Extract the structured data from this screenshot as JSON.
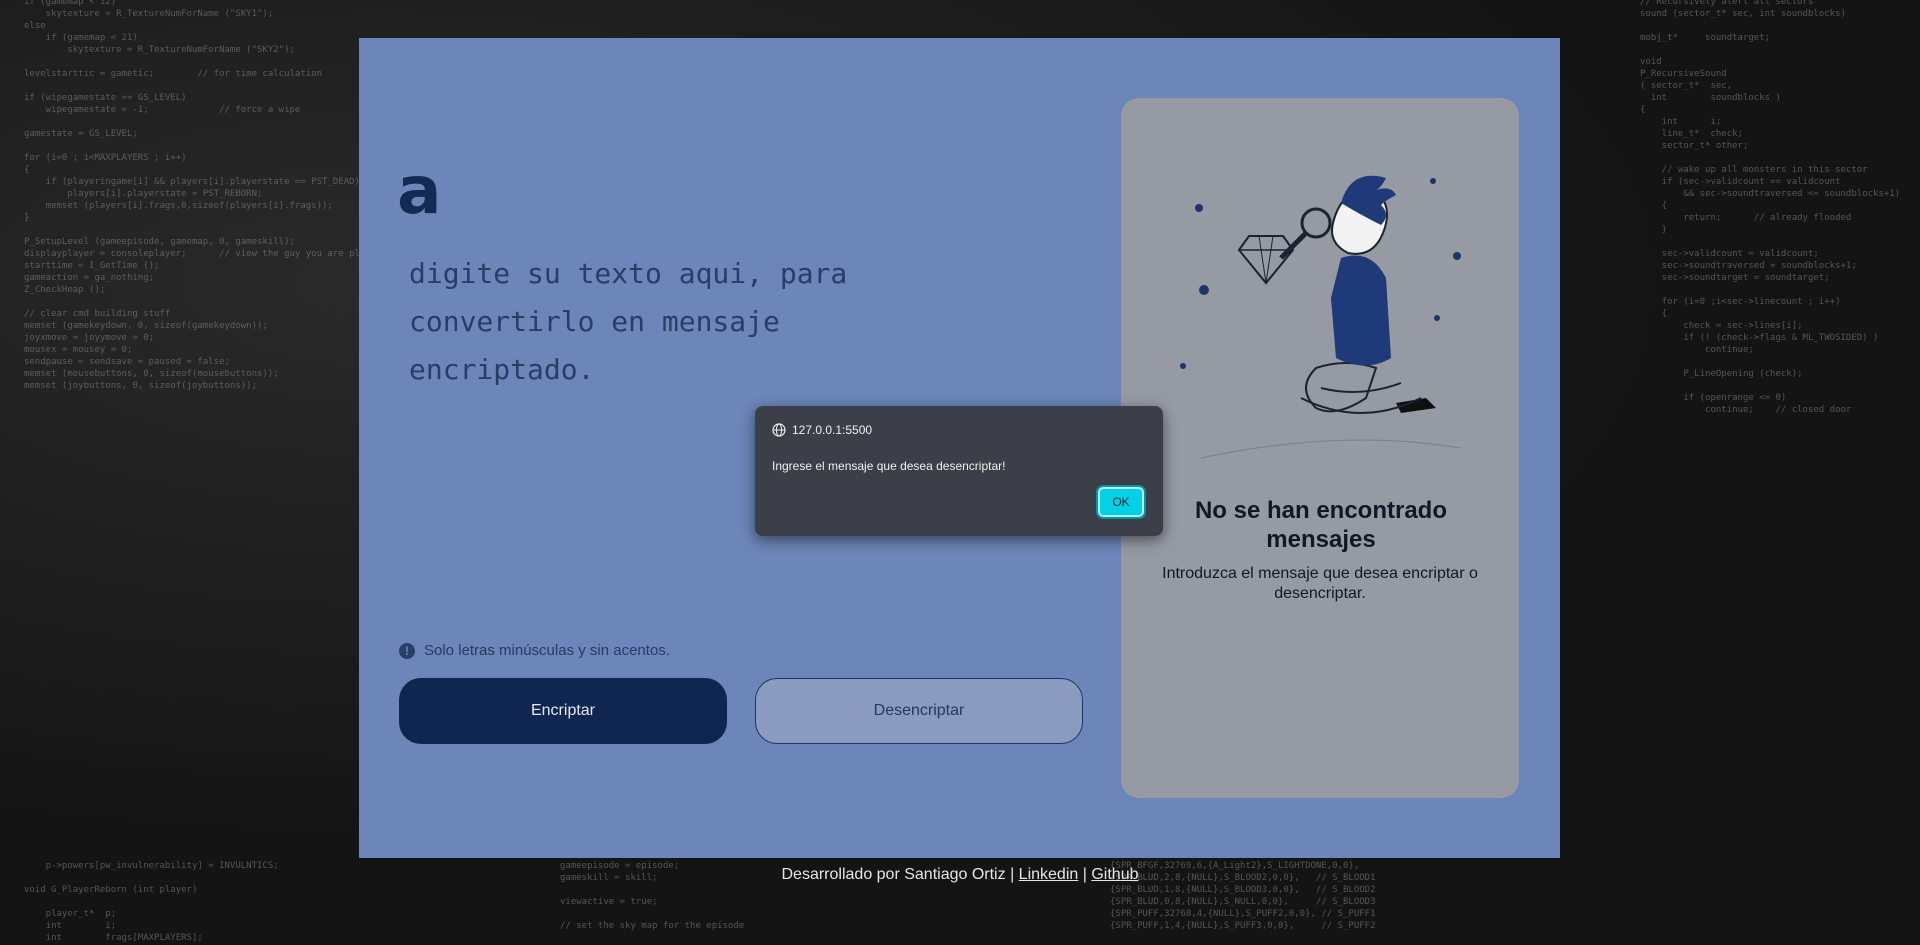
{
  "background": {
    "code_left": "if (gamemap < 12)\n    skytexture = R_TextureNumForName (\"SKY1\");\nelse\n    if (gamemap < 21)\n        skytexture = R_TextureNumForName (\"SKY2\");\n\nlevelstarttic = gametic;        // for time calculation\n\nif (wipegamestate == GS_LEVEL)\n    wipegamestate = -1;             // force a wipe\n\ngamestate = GS_LEVEL;\n\nfor (i=0 ; i<MAXPLAYERS ; i++)\n{\n    if (playeringame[i] && players[i].playerstate == PST_DEAD)\n        players[i].playerstate = PST_REBORN;\n    memset (players[i].frags,0,sizeof(players[i].frags));\n}\n\nP_SetupLevel (gameepisode, gamemap, 0, gameskill);\ndisplayplayer = consoleplayer;      // view the guy you are playing\nstarttime = I_GetTime ();\ngameaction = ga_nothing;\nZ_CheckHeap ();\n\n// clear cmd building stuff\nmemset (gamekeydown, 0, sizeof(gamekeydown));\njoyxmove = joyymove = 0;\nmousex = mousey = 0;\nsendpause = sendsave = paused = false;\nmemset (mousebuttons, 0, sizeof(mousebuttons));\nmemset (joybuttons, 0, sizeof(joybuttons));",
    "code_right": "// Recursively alert all sectors\nsound (sector_t* sec, int soundblocks)\n\nmobj_t*     soundtarget;\n\nvoid\nP_RecursiveSound\n( sector_t*  sec,\n  int        soundblocks )\n{\n    int      i;\n    line_t*  check;\n    sector_t* other;\n\n    // wake up all monsters in this sector\n    if (sec->validcount == validcount\n        && sec->soundtraversed <= soundblocks+1)\n    {\n        return;      // already flooded\n    }\n\n    sec->validcount = validcount;\n    sec->soundtraversed = soundblocks+1;\n    sec->soundtarget = soundtarget;\n\n    for (i=0 ;i<sec->linecount ; i++)\n    {\n        check = sec->lines[i];\n        if (! (check->flags & ML_TWOSIDED) )\n            continue;\n\n        P_LineOpening (check);\n\n        if (openrange <= 0)\n            continue;    // closed door\n",
    "code_bottom_a": "gameepisode = episode;\ngameskill = skill;\n\nviewactive = true;\n\n// set the sky map for the episode",
    "code_bottom_b": "{SPR_BFGF,32769,6,{A_Light2},S_LIGHTDONE,0,0},\n{SPR_BLUD,2,8,{NULL},S_BLOOD2,0,0},   // S_BLOOD1\n{SPR_BLUD,1,8,{NULL},S_BLOOD3,0,0},   // S_BLOOD2\n{SPR_BLUD,0,8,{NULL},S_NULL,0,0},     // S_BLOOD3\n{SPR_PUFF,32768,4,{NULL},S_PUFF2,0,0}, // S_PUFF1\n{SPR_PUFF,1,4,{NULL},S_PUFF3,0,0},     // S_PUFF2",
    "code_bottom_c": "    p->powers[pw_invulnerability] = INVULNTICS;\n\nvoid G_PlayerReborn (int player)\n\n    player_t*  p;\n    int        i;\n    int        frags[MAXPLAYERS];"
  },
  "app": {
    "logo": "a",
    "textarea_placeholder": "digite su texto aqui, para convertirlo en mensaje encriptado.",
    "warning": "Solo letras minúsculas y sin acentos.",
    "encrypt_button": "Encriptar",
    "decrypt_button": "Desencriptar",
    "panel_title": "No se han encontrado mensajes",
    "panel_subtitle": "Introduzca el mensaje que desea encriptar o desencriptar.",
    "colors": {
      "card": "#6c86b9",
      "primary": "#0f2650",
      "panel": "#969aa3"
    }
  },
  "footer": {
    "prefix": "Desarrollado por Santiago Ortiz",
    "separator": "|",
    "linkedin": "Linkedin",
    "github": "Github"
  },
  "dialog": {
    "origin": "127.0.0.1:5500",
    "message": "Ingrese el mensaje que desea desencriptar!",
    "ok_label": "OK",
    "origin_icon": "globe-icon"
  }
}
